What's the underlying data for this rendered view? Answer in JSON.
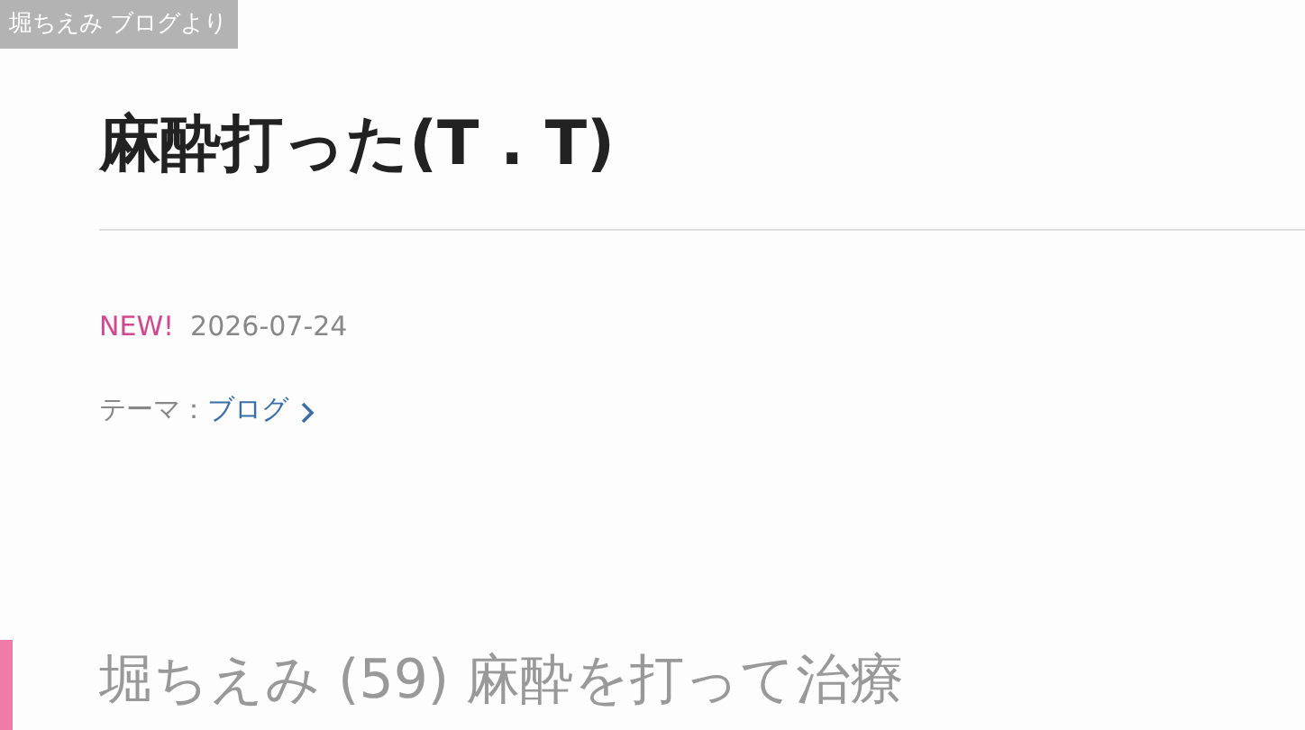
{
  "source_label": "堀ちえみ ブログより",
  "post": {
    "title": "麻酔打った(T . T)",
    "new_badge": "NEW!",
    "date": "2026-07-24",
    "theme_label": "テーマ：",
    "theme_link": "ブログ"
  },
  "caption": "堀ちえみ (59) 麻酔を打って治療"
}
